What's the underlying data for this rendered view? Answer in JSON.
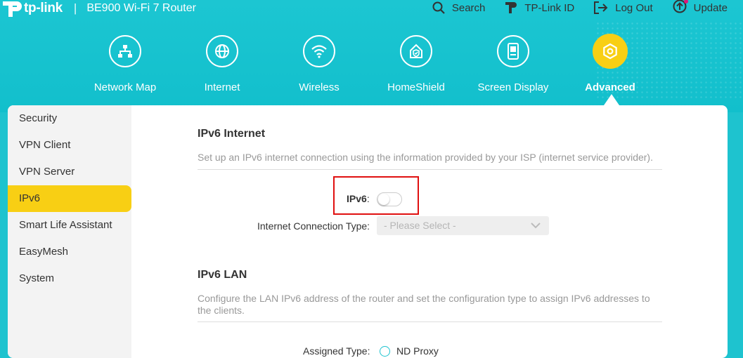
{
  "header": {
    "brand": "tp-link",
    "model": "BE900 Wi-Fi 7 Router",
    "actions": {
      "search": "Search",
      "tplink_id": "TP-Link ID",
      "logout": "Log Out",
      "update": "Update"
    }
  },
  "nav": {
    "items": [
      {
        "label": "Network Map",
        "icon": "network-map-icon"
      },
      {
        "label": "Internet",
        "icon": "globe-icon"
      },
      {
        "label": "Wireless",
        "icon": "wifi-icon"
      },
      {
        "label": "HomeShield",
        "icon": "home-shield-icon"
      },
      {
        "label": "Screen Display",
        "icon": "screen-display-icon"
      },
      {
        "label": "Advanced",
        "icon": "gear-icon",
        "active": true
      }
    ]
  },
  "sidebar": {
    "items": [
      {
        "label": "Security"
      },
      {
        "label": "VPN Client"
      },
      {
        "label": "VPN Server"
      },
      {
        "label": "IPv6",
        "active": true
      },
      {
        "label": "Smart Life Assistant"
      },
      {
        "label": "EasyMesh"
      },
      {
        "label": "System"
      }
    ]
  },
  "ipv6_internet": {
    "title": "IPv6 Internet",
    "description": "Set up an IPv6 internet connection using the information provided by your ISP (internet service provider).",
    "toggle_label": "IPv6",
    "toggle_colon": ":",
    "toggle_on": false,
    "connection_type_label": "Internet Connection Type:",
    "connection_type_value": "- Please Select -"
  },
  "ipv6_lan": {
    "title": "IPv6 LAN",
    "description": "Configure the LAN IPv6 address of the router and set the configuration type to assign IPv6 addresses to the clients.",
    "assigned_type_label": "Assigned Type:",
    "assigned_type_option": "ND Proxy"
  },
  "colors": {
    "header_bg": "#1ec3cf",
    "accent_yellow": "#f8cf14",
    "highlight_red": "#e01010"
  }
}
